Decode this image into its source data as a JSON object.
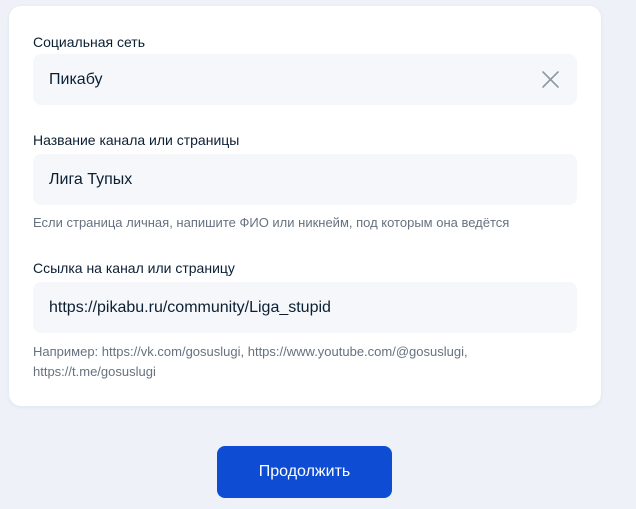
{
  "form": {
    "social_network": {
      "label": "Социальная сеть",
      "value": "Пикабу",
      "clear_icon": "close-icon"
    },
    "channel_name": {
      "label": "Название канала или страницы",
      "value": "Лига Тупых",
      "hint": "Если страница личная, напишите ФИО или никнейм, под которым она ведётся"
    },
    "channel_link": {
      "label": "Ссылка на канал или страницу",
      "value": "https://pikabu.ru/community/Liga_stupid",
      "hint": "Например: https://vk.com/gosuslugi, https://www.youtube.com/@gosuslugi, https://t.me/gosuslugi"
    }
  },
  "actions": {
    "continue_label": "Продолжить"
  },
  "colors": {
    "primary": "#0d4cd3",
    "page_background": "#eef2f8",
    "input_background": "#f5f7fa",
    "text": "#0b1f33",
    "hint_text": "#66727f"
  }
}
